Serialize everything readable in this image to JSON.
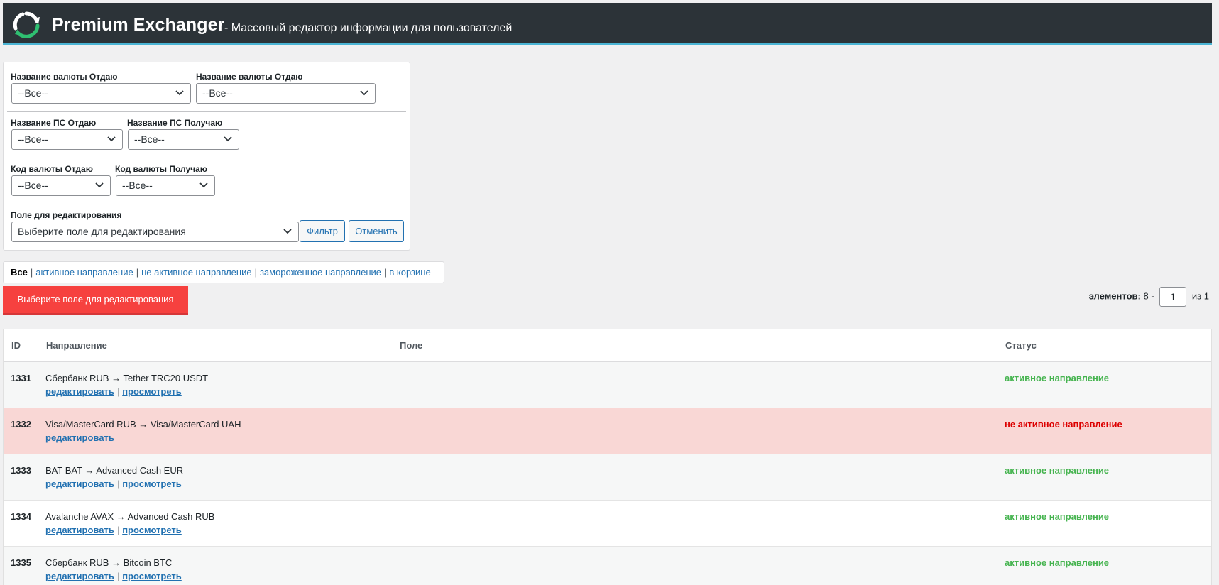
{
  "header": {
    "app_name": "Premium Exchanger",
    "subtitle": "- Массовый редактор информации для пользователей",
    "logo_icon": "refresh-arrows-icon"
  },
  "filters": {
    "currency_give_label": "Название валюты Отдаю",
    "currency_give_value": "--Все--",
    "currency_get_label": "Название валюты Отдаю",
    "currency_get_value": "--Все--",
    "ps_give_label": "Название ПС Отдаю",
    "ps_give_value": "--Все--",
    "ps_get_label": "Название ПС Получаю",
    "ps_get_value": "--Все--",
    "code_give_label": "Код валюты Отдаю",
    "code_give_value": "--Все--",
    "code_get_label": "Код валюты Получаю",
    "code_get_value": "--Все--",
    "edit_field_label": "Поле для редактирования",
    "edit_field_value": "Выберите поле для редактирования",
    "filter_button": "Фильтр",
    "cancel_button": "Отменить"
  },
  "status_tabs": {
    "all": "Все",
    "active": "активное направление",
    "inactive": "не активное направление",
    "frozen": "замороженное направление",
    "trash": "в корзине",
    "separator": "|"
  },
  "bulk_button": "Выберите поле для редактирования",
  "pagination": {
    "label": "элементов:",
    "count": "8 -",
    "page": "1",
    "of": "из",
    "total_pages": "1"
  },
  "table": {
    "columns": [
      "ID",
      "Направление",
      "Поле",
      "Статус"
    ],
    "edit_link": "редактировать",
    "view_link": "просмотреть",
    "rows": [
      {
        "id": "1331",
        "direction": "Сбербанк RUB → Tether TRC20 USDT",
        "status": "активное направление"
      },
      {
        "id": "1332",
        "direction": "Visa/MasterCard RUB → Visa/MasterCard UAH",
        "status": "не активное направление"
      },
      {
        "id": "1333",
        "direction": "BAT BAT → Advanced Cash EUR",
        "status": "активное направление"
      },
      {
        "id": "1334",
        "direction": "Avalanche AVAX → Advanced Cash RUB",
        "status": "активное направление"
      },
      {
        "id": "1335",
        "direction": "Сбербанк RUB → Bitcoin BTC",
        "status": "активное направление"
      }
    ]
  },
  "colors": {
    "active_status": "#46b450",
    "inactive_status": "#dc0000",
    "inactive_row_bg": "#f9d7d5",
    "bulk_button_bg": "#f6413f",
    "header_bg": "#2c3338",
    "link": "#2271b1"
  }
}
